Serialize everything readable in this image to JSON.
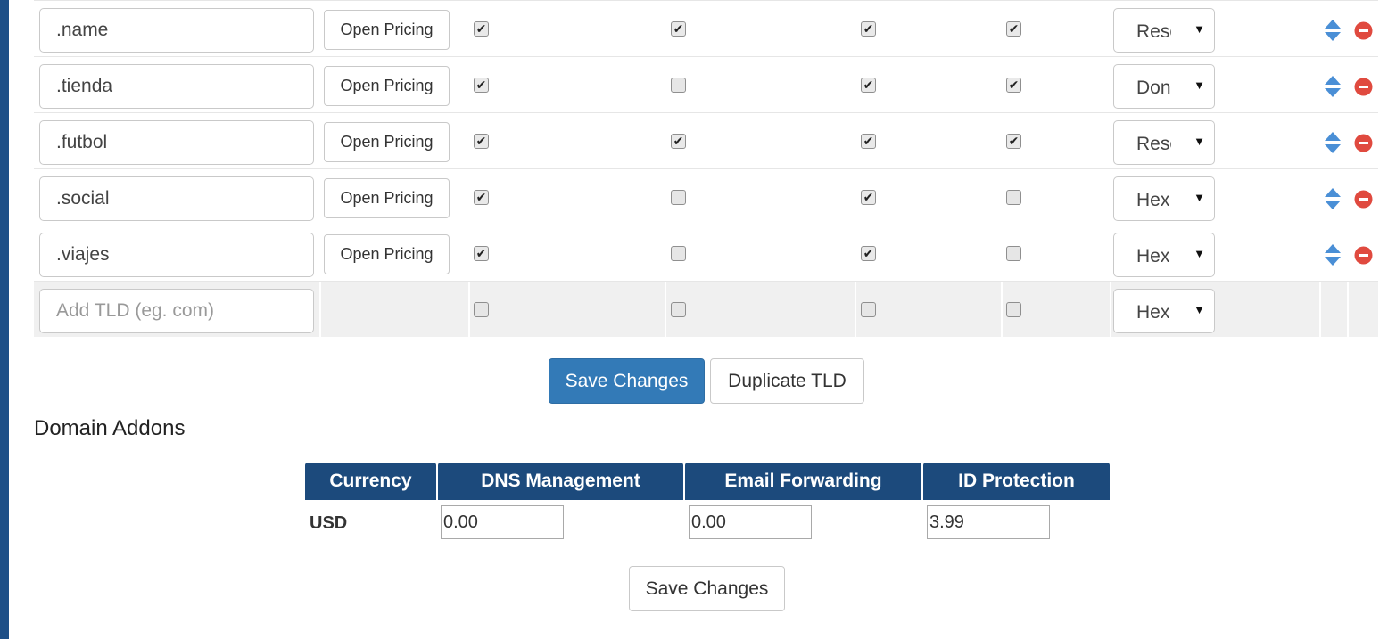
{
  "tld_table": {
    "rows": [
      {
        "tld": ".name",
        "pricing_label": "Open Pricing",
        "dns": true,
        "email": true,
        "idp": true,
        "epp": true,
        "registrar": "Rese"
      },
      {
        "tld": ".tienda",
        "pricing_label": "Open Pricing",
        "dns": true,
        "email": false,
        "idp": true,
        "epp": true,
        "registrar": "Don"
      },
      {
        "tld": ".futbol",
        "pricing_label": "Open Pricing",
        "dns": true,
        "email": true,
        "idp": true,
        "epp": true,
        "registrar": "Rese"
      },
      {
        "tld": ".social",
        "pricing_label": "Open Pricing",
        "dns": true,
        "email": false,
        "idp": true,
        "epp": false,
        "registrar": "Hex"
      },
      {
        "tld": ".viajes",
        "pricing_label": "Open Pricing",
        "dns": true,
        "email": false,
        "idp": true,
        "epp": false,
        "registrar": "Hex"
      }
    ],
    "add_row": {
      "placeholder": "Add TLD (eg. com)",
      "dns": false,
      "email": false,
      "idp": false,
      "epp": false,
      "registrar": "Hex"
    },
    "check_glyph": "✔",
    "select_arrow": "▼"
  },
  "buttons": {
    "save_changes": "Save Changes",
    "duplicate_tld": "Duplicate TLD",
    "save_changes_addons": "Save Changes"
  },
  "domain_addons": {
    "title": "Domain Addons",
    "headers": {
      "currency": "Currency",
      "dns": "DNS Management",
      "email": "Email Forwarding",
      "idp": "ID Protection"
    },
    "row": {
      "currency": "USD",
      "dns": "0.00",
      "email": "0.00",
      "idp": "3.99"
    }
  },
  "colors": {
    "primary": "#337ab7",
    "header_bg": "#1c4a7c",
    "sidebar": "#1d4f87",
    "delete_icon": "#e04a3f",
    "sort_icon": "#4a8fd6"
  },
  "icons": {
    "sort": "sort-up-down-icon",
    "delete": "remove-circle-icon"
  }
}
